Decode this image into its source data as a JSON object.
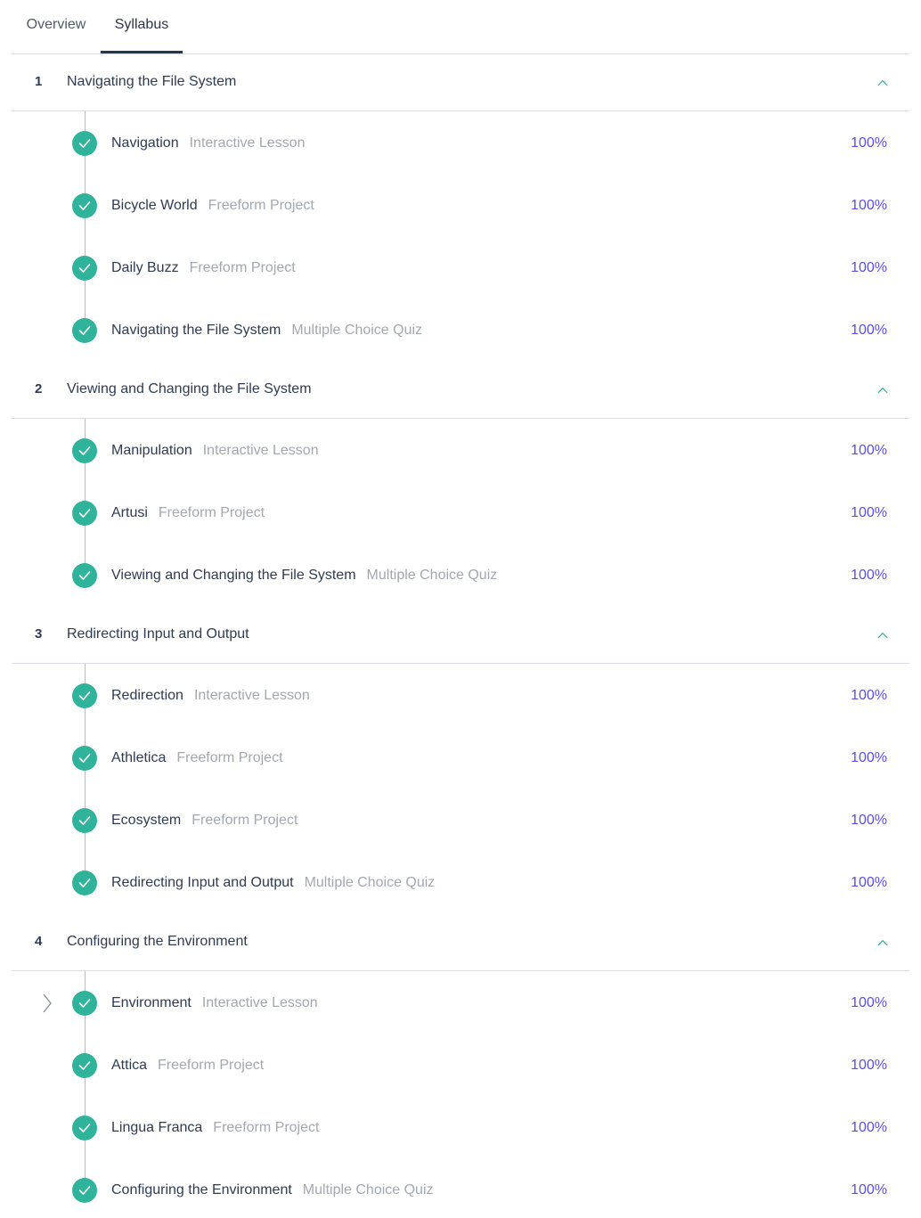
{
  "tabs": [
    {
      "label": "Overview",
      "active": false
    },
    {
      "label": "Syllabus",
      "active": true
    }
  ],
  "colors": {
    "accent_green": "#2fb39a",
    "progress_purple": "#5a4ee8",
    "active_tab_underline": "#1f3a4f"
  },
  "modules": [
    {
      "number": "1",
      "title": "Navigating the File System",
      "expanded": true,
      "items": [
        {
          "title": "Navigation",
          "type": "Interactive Lesson",
          "progress": "100%",
          "completed": true
        },
        {
          "title": "Bicycle World",
          "type": "Freeform Project",
          "progress": "100%",
          "completed": true
        },
        {
          "title": "Daily Buzz",
          "type": "Freeform Project",
          "progress": "100%",
          "completed": true
        },
        {
          "title": "Navigating the File System",
          "type": "Multiple Choice Quiz",
          "progress": "100%",
          "completed": true
        }
      ]
    },
    {
      "number": "2",
      "title": "Viewing and Changing the File System",
      "expanded": true,
      "items": [
        {
          "title": "Manipulation",
          "type": "Interactive Lesson",
          "progress": "100%",
          "completed": true
        },
        {
          "title": "Artusi",
          "type": "Freeform Project",
          "progress": "100%",
          "completed": true
        },
        {
          "title": "Viewing and Changing the File System",
          "type": "Multiple Choice Quiz",
          "progress": "100%",
          "completed": true
        }
      ]
    },
    {
      "number": "3",
      "title": "Redirecting Input and Output",
      "expanded": true,
      "items": [
        {
          "title": "Redirection",
          "type": "Interactive Lesson",
          "progress": "100%",
          "completed": true
        },
        {
          "title": "Athletica",
          "type": "Freeform Project",
          "progress": "100%",
          "completed": true
        },
        {
          "title": "Ecosystem",
          "type": "Freeform Project",
          "progress": "100%",
          "completed": true
        },
        {
          "title": "Redirecting Input and Output",
          "type": "Multiple Choice Quiz",
          "progress": "100%",
          "completed": true
        }
      ]
    },
    {
      "number": "4",
      "title": "Configuring the Environment",
      "expanded": true,
      "items": [
        {
          "title": "Environment",
          "type": "Interactive Lesson",
          "progress": "100%",
          "completed": true,
          "current": true
        },
        {
          "title": "Attica",
          "type": "Freeform Project",
          "progress": "100%",
          "completed": true
        },
        {
          "title": "Lingua Franca",
          "type": "Freeform Project",
          "progress": "100%",
          "completed": true
        },
        {
          "title": "Configuring the Environment",
          "type": "Multiple Choice Quiz",
          "progress": "100%",
          "completed": true
        }
      ]
    }
  ]
}
